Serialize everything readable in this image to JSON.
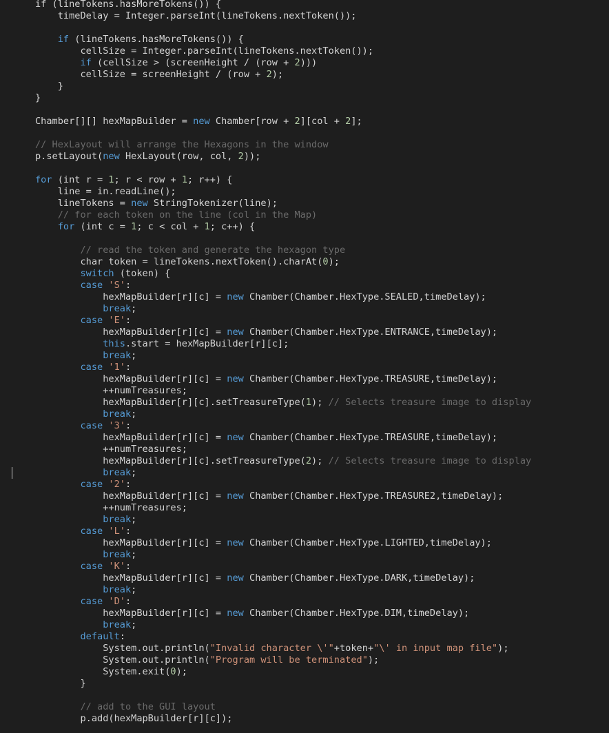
{
  "editor": {
    "colors": {
      "background": "#1e1e1e",
      "text": "#d4d4d4",
      "keyword": "#569cd6",
      "string": "#ce9178",
      "number": "#b5cea8",
      "comment": "#6a6a6a"
    },
    "lines": [
      [
        [
          "plain",
          "if"
        ],
        [
          "plain",
          " (lineTokens.hasMoreTokens()) {"
        ]
      ],
      [
        [
          "plain",
          "    timeDelay = Integer.parseInt(lineTokens.nextToken());"
        ]
      ],
      [
        [
          "plain",
          ""
        ]
      ],
      [
        [
          "plain",
          "    "
        ],
        [
          "kw",
          "if"
        ],
        [
          "plain",
          " (lineTokens.hasMoreTokens()) {"
        ]
      ],
      [
        [
          "plain",
          "        cellSize = Integer.parseInt(lineTokens.nextToken());"
        ]
      ],
      [
        [
          "plain",
          "        "
        ],
        [
          "kw",
          "if"
        ],
        [
          "plain",
          " (cellSize > (screenHeight / (row + "
        ],
        [
          "num",
          "2"
        ],
        [
          "plain",
          ")))"
        ]
      ],
      [
        [
          "plain",
          "        cellSize = screenHeight / (row + "
        ],
        [
          "num",
          "2"
        ],
        [
          "plain",
          ");"
        ]
      ],
      [
        [
          "plain",
          "    }"
        ]
      ],
      [
        [
          "plain",
          "}"
        ]
      ],
      [
        [
          "plain",
          ""
        ]
      ],
      [
        [
          "plain",
          "Chamber[][] hexMapBuilder = "
        ],
        [
          "kw",
          "new"
        ],
        [
          "plain",
          " Chamber[row + "
        ],
        [
          "num",
          "2"
        ],
        [
          "plain",
          "][col + "
        ],
        [
          "num",
          "2"
        ],
        [
          "plain",
          "];"
        ]
      ],
      [
        [
          "plain",
          ""
        ]
      ],
      [
        [
          "cmt",
          "// HexLayout will arrange the Hexagons in the window"
        ]
      ],
      [
        [
          "plain",
          "p.setLayout("
        ],
        [
          "kw",
          "new"
        ],
        [
          "plain",
          " HexLayout(row, col, "
        ],
        [
          "num",
          "2"
        ],
        [
          "plain",
          "));"
        ]
      ],
      [
        [
          "plain",
          ""
        ]
      ],
      [
        [
          "kw",
          "for"
        ],
        [
          "plain",
          " (int r = "
        ],
        [
          "num",
          "1"
        ],
        [
          "plain",
          "; r < row + "
        ],
        [
          "num",
          "1"
        ],
        [
          "plain",
          "; r++) {"
        ]
      ],
      [
        [
          "plain",
          "    line = in.readLine();"
        ]
      ],
      [
        [
          "plain",
          "    lineTokens = "
        ],
        [
          "kw",
          "new"
        ],
        [
          "plain",
          " StringTokenizer(line);"
        ]
      ],
      [
        [
          "plain",
          "    "
        ],
        [
          "cmt",
          "// for each token on the line (col in the Map)"
        ]
      ],
      [
        [
          "plain",
          "    "
        ],
        [
          "kw",
          "for"
        ],
        [
          "plain",
          " (int c = "
        ],
        [
          "num",
          "1"
        ],
        [
          "plain",
          "; c < col + "
        ],
        [
          "num",
          "1"
        ],
        [
          "plain",
          "; c++) {"
        ]
      ],
      [
        [
          "plain",
          ""
        ]
      ],
      [
        [
          "plain",
          "        "
        ],
        [
          "cmt",
          "// read the token and generate the hexagon type"
        ]
      ],
      [
        [
          "plain",
          "        char token = lineTokens.nextToken().charAt("
        ],
        [
          "num",
          "0"
        ],
        [
          "plain",
          ");"
        ]
      ],
      [
        [
          "plain",
          "        "
        ],
        [
          "kw",
          "switch"
        ],
        [
          "plain",
          " (token) {"
        ]
      ],
      [
        [
          "plain",
          "        "
        ],
        [
          "kw",
          "case"
        ],
        [
          "plain",
          " "
        ],
        [
          "str",
          "'S'"
        ],
        [
          "plain",
          ":"
        ]
      ],
      [
        [
          "plain",
          "            hexMapBuilder[r][c] = "
        ],
        [
          "kw",
          "new"
        ],
        [
          "plain",
          " Chamber(Chamber.HexType.SEALED,timeDelay);"
        ]
      ],
      [
        [
          "plain",
          "            "
        ],
        [
          "kw",
          "break"
        ],
        [
          "plain",
          ";"
        ]
      ],
      [
        [
          "plain",
          "        "
        ],
        [
          "kw",
          "case"
        ],
        [
          "plain",
          " "
        ],
        [
          "str",
          "'E'"
        ],
        [
          "plain",
          ":"
        ]
      ],
      [
        [
          "plain",
          "            hexMapBuilder[r][c] = "
        ],
        [
          "kw",
          "new"
        ],
        [
          "plain",
          " Chamber(Chamber.HexType.ENTRANCE,timeDelay);"
        ]
      ],
      [
        [
          "plain",
          "            "
        ],
        [
          "kw",
          "this"
        ],
        [
          "plain",
          ".start = hexMapBuilder[r][c];"
        ]
      ],
      [
        [
          "plain",
          "            "
        ],
        [
          "kw",
          "break"
        ],
        [
          "plain",
          ";"
        ]
      ],
      [
        [
          "plain",
          "        "
        ],
        [
          "kw",
          "case"
        ],
        [
          "plain",
          " "
        ],
        [
          "str",
          "'1'"
        ],
        [
          "plain",
          ":"
        ]
      ],
      [
        [
          "plain",
          "            hexMapBuilder[r][c] = "
        ],
        [
          "kw",
          "new"
        ],
        [
          "plain",
          " Chamber(Chamber.HexType.TREASURE,timeDelay);"
        ]
      ],
      [
        [
          "plain",
          "            ++numTreasures;"
        ]
      ],
      [
        [
          "plain",
          "            hexMapBuilder[r][c].setTreasureType("
        ],
        [
          "num",
          "1"
        ],
        [
          "plain",
          "); "
        ],
        [
          "cmt",
          "// Selects treasure image to display"
        ]
      ],
      [
        [
          "plain",
          "            "
        ],
        [
          "kw",
          "break"
        ],
        [
          "plain",
          ";"
        ]
      ],
      [
        [
          "plain",
          "        "
        ],
        [
          "kw",
          "case"
        ],
        [
          "plain",
          " "
        ],
        [
          "str",
          "'3'"
        ],
        [
          "plain",
          ":"
        ]
      ],
      [
        [
          "plain",
          "            hexMapBuilder[r][c] = "
        ],
        [
          "kw",
          "new"
        ],
        [
          "plain",
          " Chamber(Chamber.HexType.TREASURE,timeDelay);"
        ]
      ],
      [
        [
          "plain",
          "            ++numTreasures;"
        ]
      ],
      [
        [
          "plain",
          "            hexMapBuilder[r][c].setTreasureType("
        ],
        [
          "num",
          "2"
        ],
        [
          "plain",
          "); "
        ],
        [
          "cmt",
          "// Selects treasure image to display"
        ]
      ],
      [
        [
          "plain",
          "            "
        ],
        [
          "kw",
          "break"
        ],
        [
          "plain",
          ";"
        ]
      ],
      [
        [
          "plain",
          "        "
        ],
        [
          "kw",
          "case"
        ],
        [
          "plain",
          " "
        ],
        [
          "str",
          "'2'"
        ],
        [
          "plain",
          ":"
        ]
      ],
      [
        [
          "plain",
          "            hexMapBuilder[r][c] = "
        ],
        [
          "kw",
          "new"
        ],
        [
          "plain",
          " Chamber(Chamber.HexType.TREASURE2,timeDelay);"
        ]
      ],
      [
        [
          "plain",
          "            ++numTreasures;"
        ]
      ],
      [
        [
          "plain",
          "            "
        ],
        [
          "kw",
          "break"
        ],
        [
          "plain",
          ";"
        ]
      ],
      [
        [
          "plain",
          "        "
        ],
        [
          "kw",
          "case"
        ],
        [
          "plain",
          " "
        ],
        [
          "str",
          "'L'"
        ],
        [
          "plain",
          ":"
        ]
      ],
      [
        [
          "plain",
          "            hexMapBuilder[r][c] = "
        ],
        [
          "kw",
          "new"
        ],
        [
          "plain",
          " Chamber(Chamber.HexType.LIGHTED,timeDelay);"
        ]
      ],
      [
        [
          "plain",
          "            "
        ],
        [
          "kw",
          "break"
        ],
        [
          "plain",
          ";"
        ]
      ],
      [
        [
          "plain",
          "        "
        ],
        [
          "kw",
          "case"
        ],
        [
          "plain",
          " "
        ],
        [
          "str",
          "'K'"
        ],
        [
          "plain",
          ":"
        ]
      ],
      [
        [
          "plain",
          "            hexMapBuilder[r][c] = "
        ],
        [
          "kw",
          "new"
        ],
        [
          "plain",
          " Chamber(Chamber.HexType.DARK,timeDelay);"
        ]
      ],
      [
        [
          "plain",
          "            "
        ],
        [
          "kw",
          "break"
        ],
        [
          "plain",
          ";"
        ]
      ],
      [
        [
          "plain",
          "        "
        ],
        [
          "kw",
          "case"
        ],
        [
          "plain",
          " "
        ],
        [
          "str",
          "'D'"
        ],
        [
          "plain",
          ":"
        ]
      ],
      [
        [
          "plain",
          "            hexMapBuilder[r][c] = "
        ],
        [
          "kw",
          "new"
        ],
        [
          "plain",
          " Chamber(Chamber.HexType.DIM,timeDelay);"
        ]
      ],
      [
        [
          "plain",
          "            "
        ],
        [
          "kw",
          "break"
        ],
        [
          "plain",
          ";"
        ]
      ],
      [
        [
          "plain",
          "        "
        ],
        [
          "kw",
          "default"
        ],
        [
          "plain",
          ":"
        ]
      ],
      [
        [
          "plain",
          "            System.out.println("
        ],
        [
          "str",
          "\"Invalid character \\'\""
        ],
        [
          "plain",
          "+token+"
        ],
        [
          "str",
          "\"\\' in input map file\""
        ],
        [
          "plain",
          ");"
        ]
      ],
      [
        [
          "plain",
          "            System.out.println("
        ],
        [
          "str",
          "\"Program will be terminated\""
        ],
        [
          "plain",
          ");"
        ]
      ],
      [
        [
          "plain",
          "            System.exit("
        ],
        [
          "num",
          "0"
        ],
        [
          "plain",
          ");"
        ]
      ],
      [
        [
          "plain",
          "        }"
        ]
      ],
      [
        [
          "plain",
          ""
        ]
      ],
      [
        [
          "plain",
          "        "
        ],
        [
          "cmt",
          "// add to the GUI layout"
        ]
      ],
      [
        [
          "plain",
          "        p.add(hexMapBuilder[r][c]);"
        ]
      ]
    ]
  }
}
